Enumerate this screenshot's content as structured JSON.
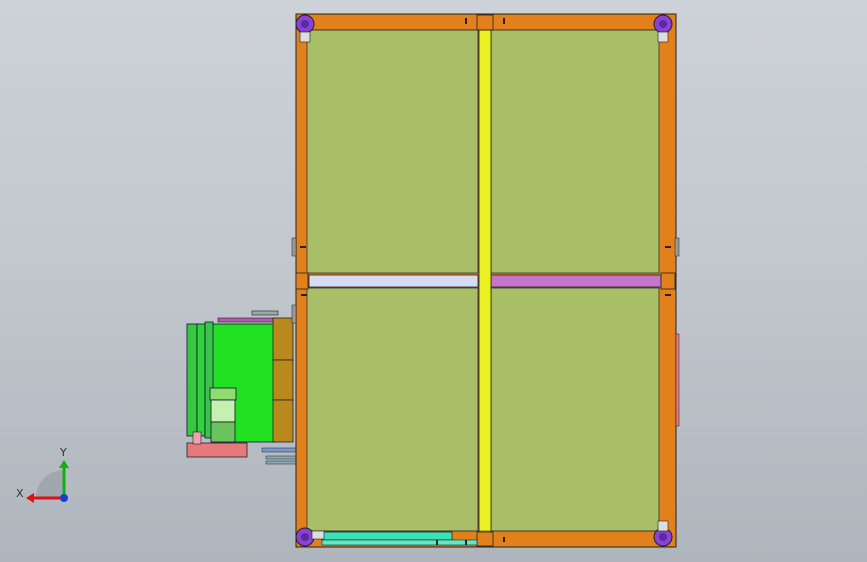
{
  "viewport": {
    "background_top": "#cdd2d8",
    "background_bottom": "#aeb5bc"
  },
  "model": {
    "panel_color": "#a9bf67",
    "frame_color": "#e2811c",
    "center_beam_color": "#e8f221",
    "left_crossbar_color": "#d7dcf2",
    "right_crossbar_color": "#c675c9",
    "caster_color": "#8a42d2",
    "motor_color": "#22e022",
    "gearbox_color": "#b9891d",
    "base_color": "#e5797c",
    "bottom_rail_color": "#39e3b7"
  },
  "triad": {
    "x_label": "X",
    "y_label": "Y",
    "x_color": "#e01010",
    "y_color": "#10b010",
    "z_color": "#1a3cd0"
  }
}
